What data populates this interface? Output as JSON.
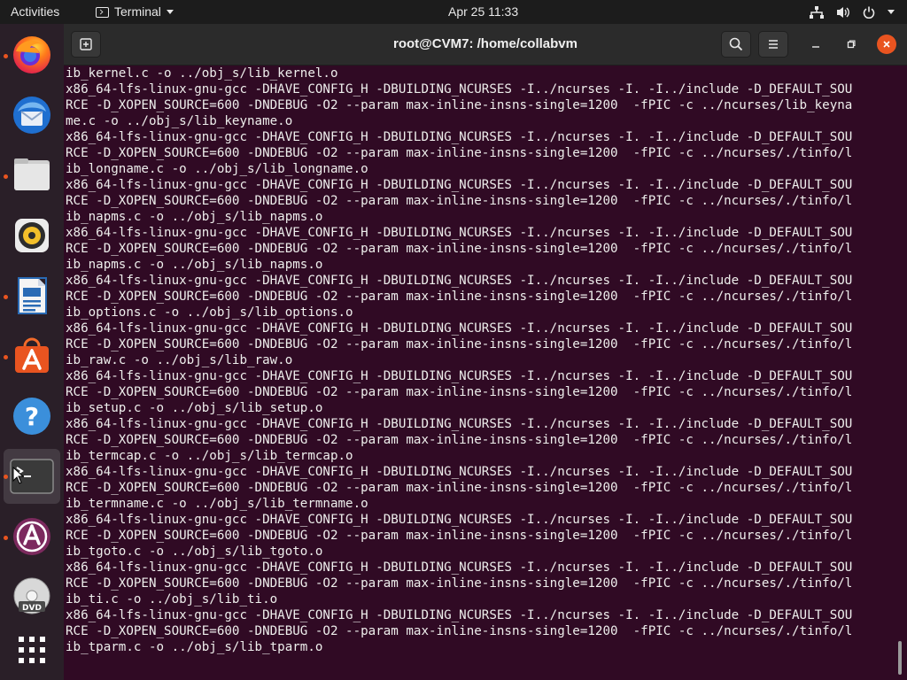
{
  "topbar": {
    "activities": "Activities",
    "app_name": "Terminal",
    "clock": "Apr 25  11:33",
    "icons": [
      "network-icon",
      "volume-icon",
      "power-icon",
      "system-menu-caret-icon"
    ]
  },
  "dock": {
    "items": [
      {
        "name": "firefox",
        "icon": "firefox-icon",
        "running": true,
        "active": false
      },
      {
        "name": "thunderbird",
        "icon": "thunderbird-icon",
        "running": false,
        "active": false
      },
      {
        "name": "files",
        "icon": "files-icon",
        "running": true,
        "active": false
      },
      {
        "name": "rhythmbox",
        "icon": "rhythmbox-icon",
        "running": false,
        "active": false
      },
      {
        "name": "libreoffice-writer",
        "icon": "writer-icon",
        "running": true,
        "active": false
      },
      {
        "name": "ubuntu-software",
        "icon": "software-icon",
        "running": true,
        "active": false
      },
      {
        "name": "help",
        "icon": "help-icon",
        "running": false,
        "active": false
      },
      {
        "name": "terminal",
        "icon": "terminal-icon",
        "running": true,
        "active": true
      },
      {
        "name": "software-updater",
        "icon": "updater-icon",
        "running": true,
        "active": false
      },
      {
        "name": "dvd",
        "icon": "dvd-icon",
        "running": false,
        "active": false
      },
      {
        "name": "show-applications",
        "icon": "app-grid-icon",
        "running": false,
        "active": false
      }
    ]
  },
  "window": {
    "title": "root@CVM7: /home/collabvm",
    "accent": "#e95420",
    "background": "#300a24"
  },
  "terminal": {
    "lines": [
      "ib_kernel.c -o ../obj_s/lib_kernel.o",
      "x86_64-lfs-linux-gnu-gcc -DHAVE_CONFIG_H -DBUILDING_NCURSES -I../ncurses -I. -I../include -D_DEFAULT_SOU",
      "RCE -D_XOPEN_SOURCE=600 -DNDEBUG -O2 --param max-inline-insns-single=1200  -fPIC -c ../ncurses/lib_keyna",
      "me.c -o ../obj_s/lib_keyname.o",
      "x86_64-lfs-linux-gnu-gcc -DHAVE_CONFIG_H -DBUILDING_NCURSES -I../ncurses -I. -I../include -D_DEFAULT_SOU",
      "RCE -D_XOPEN_SOURCE=600 -DNDEBUG -O2 --param max-inline-insns-single=1200  -fPIC -c ../ncurses/./tinfo/l",
      "ib_longname.c -o ../obj_s/lib_longname.o",
      "x86_64-lfs-linux-gnu-gcc -DHAVE_CONFIG_H -DBUILDING_NCURSES -I../ncurses -I. -I../include -D_DEFAULT_SOU",
      "RCE -D_XOPEN_SOURCE=600 -DNDEBUG -O2 --param max-inline-insns-single=1200  -fPIC -c ../ncurses/./tinfo/l",
      "ib_napms.c -o ../obj_s/lib_napms.o",
      "x86_64-lfs-linux-gnu-gcc -DHAVE_CONFIG_H -DBUILDING_NCURSES -I../ncurses -I. -I../include -D_DEFAULT_SOU",
      "RCE -D_XOPEN_SOURCE=600 -DNDEBUG -O2 --param max-inline-insns-single=1200  -fPIC -c ../ncurses/./tinfo/l",
      "ib_napms.c -o ../obj_s/lib_napms.o",
      "x86_64-lfs-linux-gnu-gcc -DHAVE_CONFIG_H -DBUILDING_NCURSES -I../ncurses -I. -I../include -D_DEFAULT_SOU",
      "RCE -D_XOPEN_SOURCE=600 -DNDEBUG -O2 --param max-inline-insns-single=1200  -fPIC -c ../ncurses/./tinfo/l",
      "ib_options.c -o ../obj_s/lib_options.o",
      "x86_64-lfs-linux-gnu-gcc -DHAVE_CONFIG_H -DBUILDING_NCURSES -I../ncurses -I. -I../include -D_DEFAULT_SOU",
      "RCE -D_XOPEN_SOURCE=600 -DNDEBUG -O2 --param max-inline-insns-single=1200  -fPIC -c ../ncurses/./tinfo/l",
      "ib_raw.c -o ../obj_s/lib_raw.o",
      "x86_64-lfs-linux-gnu-gcc -DHAVE_CONFIG_H -DBUILDING_NCURSES -I../ncurses -I. -I../include -D_DEFAULT_SOU",
      "RCE -D_XOPEN_SOURCE=600 -DNDEBUG -O2 --param max-inline-insns-single=1200  -fPIC -c ../ncurses/./tinfo/l",
      "ib_setup.c -o ../obj_s/lib_setup.o",
      "x86_64-lfs-linux-gnu-gcc -DHAVE_CONFIG_H -DBUILDING_NCURSES -I../ncurses -I. -I../include -D_DEFAULT_SOU",
      "RCE -D_XOPEN_SOURCE=600 -DNDEBUG -O2 --param max-inline-insns-single=1200  -fPIC -c ../ncurses/./tinfo/l",
      "ib_termcap.c -o ../obj_s/lib_termcap.o",
      "x86_64-lfs-linux-gnu-gcc -DHAVE_CONFIG_H -DBUILDING_NCURSES -I../ncurses -I. -I../include -D_DEFAULT_SOU",
      "RCE -D_XOPEN_SOURCE=600 -DNDEBUG -O2 --param max-inline-insns-single=1200  -fPIC -c ../ncurses/./tinfo/l",
      "ib_termname.c -o ../obj_s/lib_termname.o",
      "x86_64-lfs-linux-gnu-gcc -DHAVE_CONFIG_H -DBUILDING_NCURSES -I../ncurses -I. -I../include -D_DEFAULT_SOU",
      "RCE -D_XOPEN_SOURCE=600 -DNDEBUG -O2 --param max-inline-insns-single=1200  -fPIC -c ../ncurses/./tinfo/l",
      "ib_tgoto.c -o ../obj_s/lib_tgoto.o",
      "x86_64-lfs-linux-gnu-gcc -DHAVE_CONFIG_H -DBUILDING_NCURSES -I../ncurses -I. -I../include -D_DEFAULT_SOU",
      "RCE -D_XOPEN_SOURCE=600 -DNDEBUG -O2 --param max-inline-insns-single=1200  -fPIC -c ../ncurses/./tinfo/l",
      "ib_ti.c -o ../obj_s/lib_ti.o",
      "x86_64-lfs-linux-gnu-gcc -DHAVE_CONFIG_H -DBUILDING_NCURSES -I../ncurses -I. -I../include -D_DEFAULT_SOU",
      "RCE -D_XOPEN_SOURCE=600 -DNDEBUG -O2 --param max-inline-insns-single=1200  -fPIC -c ../ncurses/./tinfo/l",
      "ib_tparm.c -o ../obj_s/lib_tparm.o"
    ]
  }
}
